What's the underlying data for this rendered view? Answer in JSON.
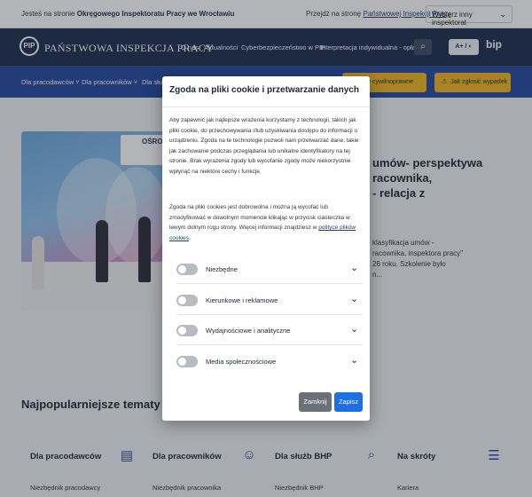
{
  "topbar": {
    "prefix": "Jesteś na stronie",
    "current_site": "Okręgowego Inspektoratu Pracy we Wrocławiu",
    "goto_prefix": "Przejdź na stronę",
    "goto_link": "Państwowej Inspekcji Pracy",
    "select_label": "Wybierz inny inspektorat"
  },
  "header": {
    "logo_mark": "PIP",
    "logo_text": "PAŃSTWOWA INSPEKCJA PRACY",
    "nav": [
      "O nas",
      "Aktualności",
      "Cyberbezpieczeństwo w PIP",
      "Interpretacja indywidualna - opłata"
    ],
    "contrast_label": "A+ / ◐",
    "bip_label": "bip"
  },
  "subnav": {
    "items": [
      "Dla pracodawców",
      "Dla pracowników",
      "Dla służb"
    ],
    "btn1": "…ścisły cywilnoprawne",
    "btn2": "Jak zgłosić wypadek"
  },
  "hero": {
    "sign_text": "OŚRODEK",
    "title_lines": [
      "umów- perspektywa",
      "racownika,",
      "- relacja z"
    ],
    "desc_lines": [
      "klasyfikacja umów -",
      "racownika, inspektora pracy\"",
      "26 roku. Szkolenie było",
      "n..."
    ]
  },
  "popular": {
    "title": "Najpopularniejsze tematy",
    "sections": [
      {
        "title": "Dla pracodawców",
        "sub": "Niezbędnik pracodawcy"
      },
      {
        "title": "Dla pracowników",
        "sub": "Niezbędnik pracownika"
      },
      {
        "title": "Dla służb BHP",
        "sub": "Niezbędnik BHP"
      },
      {
        "title": "Na skróty",
        "sub": "Kariera"
      }
    ]
  },
  "modal": {
    "title": "Zgoda na pliki cookie i przetwarzanie danych",
    "p1": "Aby zapewnić jak najlepsze wrażenia korzystamy z technologii, takich jak pliki cookie, do przechowywania i/lub uzyskiwania dostępu do informacji o urządzeniu. Zgoda na te technologie pozwoli nam przetwarzać dane, takie jak zachowanie podczas przeglądania lub unikalne identyfikatory na tej stronie. Brak wyrażenia zgody lub wycofanie zgody może niekorzystnie wpłynąć na niektóre cechy i funkcje.",
    "p2": "Zgoda na pliki cookies jest dobrowolna i można ją wycofać lub zmodyfikować w dowolnym momencie klikając w przycisk ciasteczka w lewym dolnym rogu strony. Więcej informacji znajdziesz w",
    "p2_link": "polityce plików cookies",
    "p2_end": ".",
    "categories": [
      "Niezbędne",
      "Kierunkowe i reklamowe",
      "Wydajnościowe i analityczne",
      "Media społecznościowe"
    ],
    "reject_label": "Zamknij",
    "save_label": "Zapisz"
  }
}
